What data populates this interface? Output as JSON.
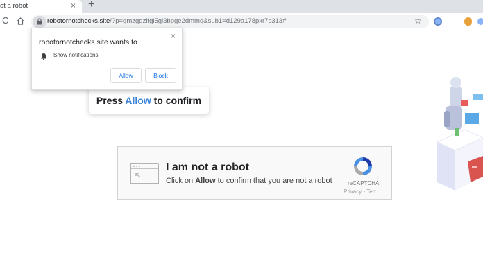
{
  "tab": {
    "title": "ot a robot",
    "close": "×",
    "new_tab": "+"
  },
  "toolbar": {
    "reload": "C",
    "url_host": "robotornotchecks.site",
    "url_path": "/?p=gmzggzlfgi5gi3bpge2dmmq&sub1=d129a178pxr7s313#",
    "star": "☆"
  },
  "notification_popup": {
    "title": "robotornotchecks.site wants to",
    "notify_text": "Show notifications",
    "close": "×",
    "allow_label": "Allow",
    "block_label": "Block"
  },
  "press_banner": {
    "prefix": "Press ",
    "highlight": "Allow",
    "suffix": " to confirm"
  },
  "captcha": {
    "title": "I am not a robot",
    "sub_prefix": "Click on ",
    "sub_bold": "Allow",
    "sub_suffix": " to confirm that you are not a robot",
    "brand": "reCAPTCHA",
    "links": "Privacy - Terr"
  },
  "colors": {
    "accent": "#1a73e8",
    "highlight": "#3b82d6",
    "tabbar": "#dee1e6"
  },
  "icons": [
    "reload-icon",
    "home-icon",
    "lock-icon",
    "star-icon",
    "bell-icon",
    "recaptcha-logo-icon",
    "window-icon"
  ]
}
